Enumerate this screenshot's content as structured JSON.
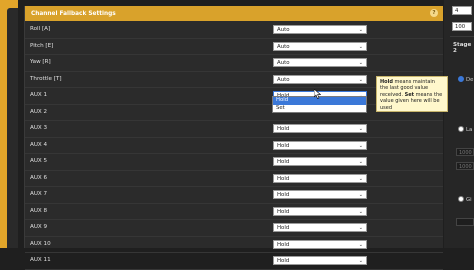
{
  "panel": {
    "title": "Channel Fallback Settings",
    "help_icon": "?",
    "rows": [
      {
        "label": "Roll [A]",
        "value": "Auto"
      },
      {
        "label": "Pitch [E]",
        "value": "Auto"
      },
      {
        "label": "Yaw [R]",
        "value": "Auto"
      },
      {
        "label": "Throttle [T]",
        "value": "Auto"
      },
      {
        "label": "AUX 1",
        "value": "Hold"
      },
      {
        "label": "AUX 2",
        "value": ""
      },
      {
        "label": "AUX 3",
        "value": "Hold"
      },
      {
        "label": "AUX 4",
        "value": "Hold"
      },
      {
        "label": "AUX 5",
        "value": "Hold"
      },
      {
        "label": "AUX 6",
        "value": "Hold"
      },
      {
        "label": "AUX 7",
        "value": "Hold"
      },
      {
        "label": "AUX 8",
        "value": "Hold"
      },
      {
        "label": "AUX 9",
        "value": "Hold"
      },
      {
        "label": "AUX 10",
        "value": "Hold"
      },
      {
        "label": "AUX 11",
        "value": "Hold"
      }
    ]
  },
  "dropdown": {
    "options": [
      "Hold",
      "Set"
    ],
    "highlighted": "Hold"
  },
  "tooltip": {
    "hold_word": "Hold",
    "hold_text": " means maintain the last good value received. ",
    "set_word": "Set",
    "set_text": " means the value given here will be used"
  },
  "sidebar": {
    "num1": "4",
    "num2": "100",
    "stage": "Stage 2",
    "radio1_label": "De",
    "radio2_label": "La",
    "radio3_label": "Gi",
    "box1": "1000",
    "box2": "1000"
  },
  "colors": {
    "accent": "#d9a22b",
    "highlight": "#3b78d8",
    "tooltip_bg": "#fff8cc"
  }
}
